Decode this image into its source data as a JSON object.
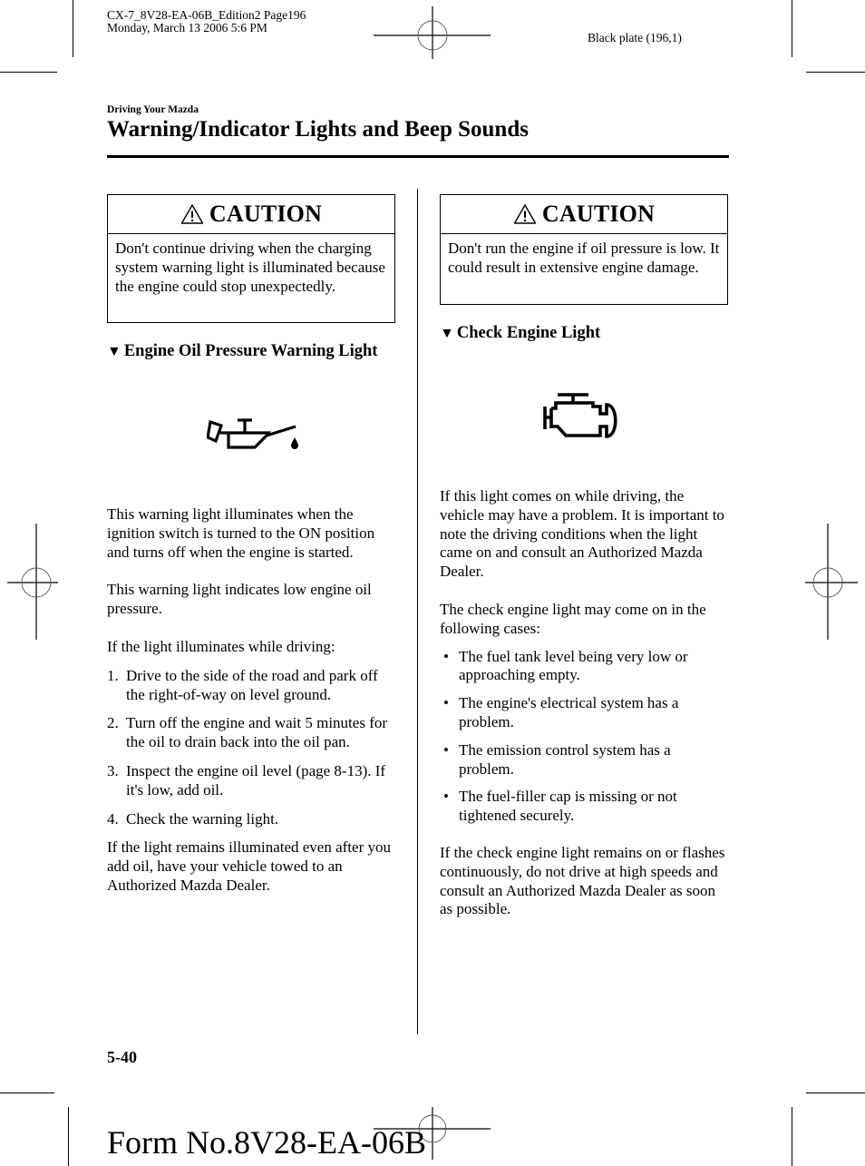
{
  "print_meta": {
    "file_line": "CX-7_8V28-EA-06B_Edition2 Page196",
    "date_line": "Monday, March 13 2006 5:6 PM",
    "plate": "Black plate (196,1)"
  },
  "header": {
    "section": "Driving Your Mazda",
    "title": "Warning/Indicator Lights and Beep Sounds"
  },
  "left_column": {
    "caution": {
      "icon": "warning-triangle-icon",
      "label": "CAUTION",
      "text": "Don't continue driving when the charging system warning light is illuminated because the engine could stop unexpectedly."
    },
    "heading": {
      "marker": "▼",
      "text": "Engine Oil Pressure Warning Light"
    },
    "symbol": "oil-can-icon",
    "paragraphs": [
      "This warning light illuminates when the ignition switch is turned to the ON position and turns off when the engine is started.",
      "This warning light indicates low engine oil pressure.",
      "If the light illuminates while driving:"
    ],
    "steps": [
      {
        "num": "1.",
        "text": "Drive to the side of the road and park off the right-of-way on level ground."
      },
      {
        "num": "2.",
        "text": "Turn off the engine and wait 5 minutes for the oil to drain back into the oil pan."
      },
      {
        "num": "3.",
        "text": "Inspect the engine oil level (page 8-13). If it's low, add oil."
      },
      {
        "num": "4.",
        "text": "Check the warning light."
      }
    ],
    "closing": "If the light remains illuminated even after you add oil, have your vehicle towed to an Authorized Mazda Dealer."
  },
  "right_column": {
    "caution": {
      "icon": "warning-triangle-icon",
      "label": "CAUTION",
      "text": "Don't run the engine if oil pressure is low. It could result in extensive engine damage."
    },
    "heading": {
      "marker": "▼",
      "text": "Check Engine Light"
    },
    "symbol": "check-engine-icon",
    "paragraphs": [
      "If this light comes on while driving, the vehicle may have a problem. It is important to note the driving conditions when the light came on and consult an Authorized Mazda Dealer.",
      "The check engine light may come on in the following cases:"
    ],
    "bullets": [
      {
        "mark": "•",
        "text": "The fuel tank level being very low or approaching empty."
      },
      {
        "mark": "•",
        "text": "The engine's electrical system has a problem."
      },
      {
        "mark": "•",
        "text": "The emission control system has a problem."
      },
      {
        "mark": "•",
        "text": "The fuel-filler cap is missing or not tightened securely."
      }
    ],
    "closing": "If the check engine light remains on or flashes continuously, do not drive at high speeds and consult an Authorized Mazda Dealer as soon as possible."
  },
  "footer": {
    "page_number": "5-40",
    "form_number": "Form No.8V28-EA-06B"
  }
}
